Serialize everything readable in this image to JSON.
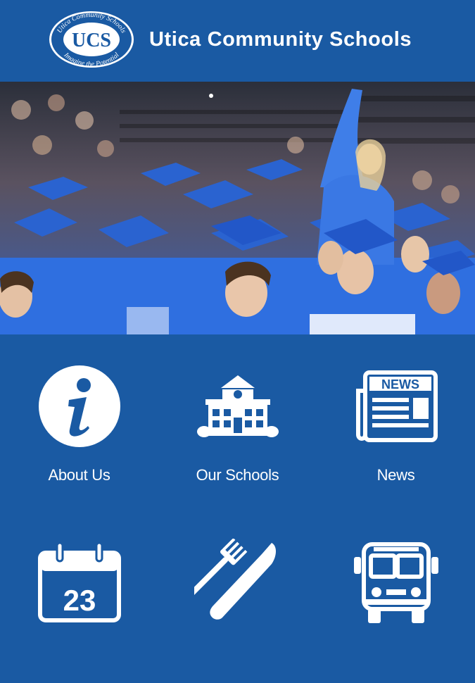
{
  "header": {
    "title": "Utica Community Schools",
    "logo": {
      "monogram": "UCS",
      "top_text": "Utica Community Schools",
      "bottom_text": "Imagine the Potential"
    }
  },
  "hero": {
    "description_icon": "graduation-photo"
  },
  "menu": [
    {
      "label": "About Us",
      "icon": "info-icon"
    },
    {
      "label": "Our Schools",
      "icon": "school-icon"
    },
    {
      "label": "News",
      "icon": "newspaper-icon",
      "icon_text": "NEWS"
    },
    {
      "label": "",
      "icon": "calendar-icon",
      "icon_text": "23"
    },
    {
      "label": "",
      "icon": "fork-knife-icon"
    },
    {
      "label": "",
      "icon": "bus-icon"
    }
  ],
  "colors": {
    "brand_blue": "#1a5aa3",
    "white": "#ffffff"
  }
}
